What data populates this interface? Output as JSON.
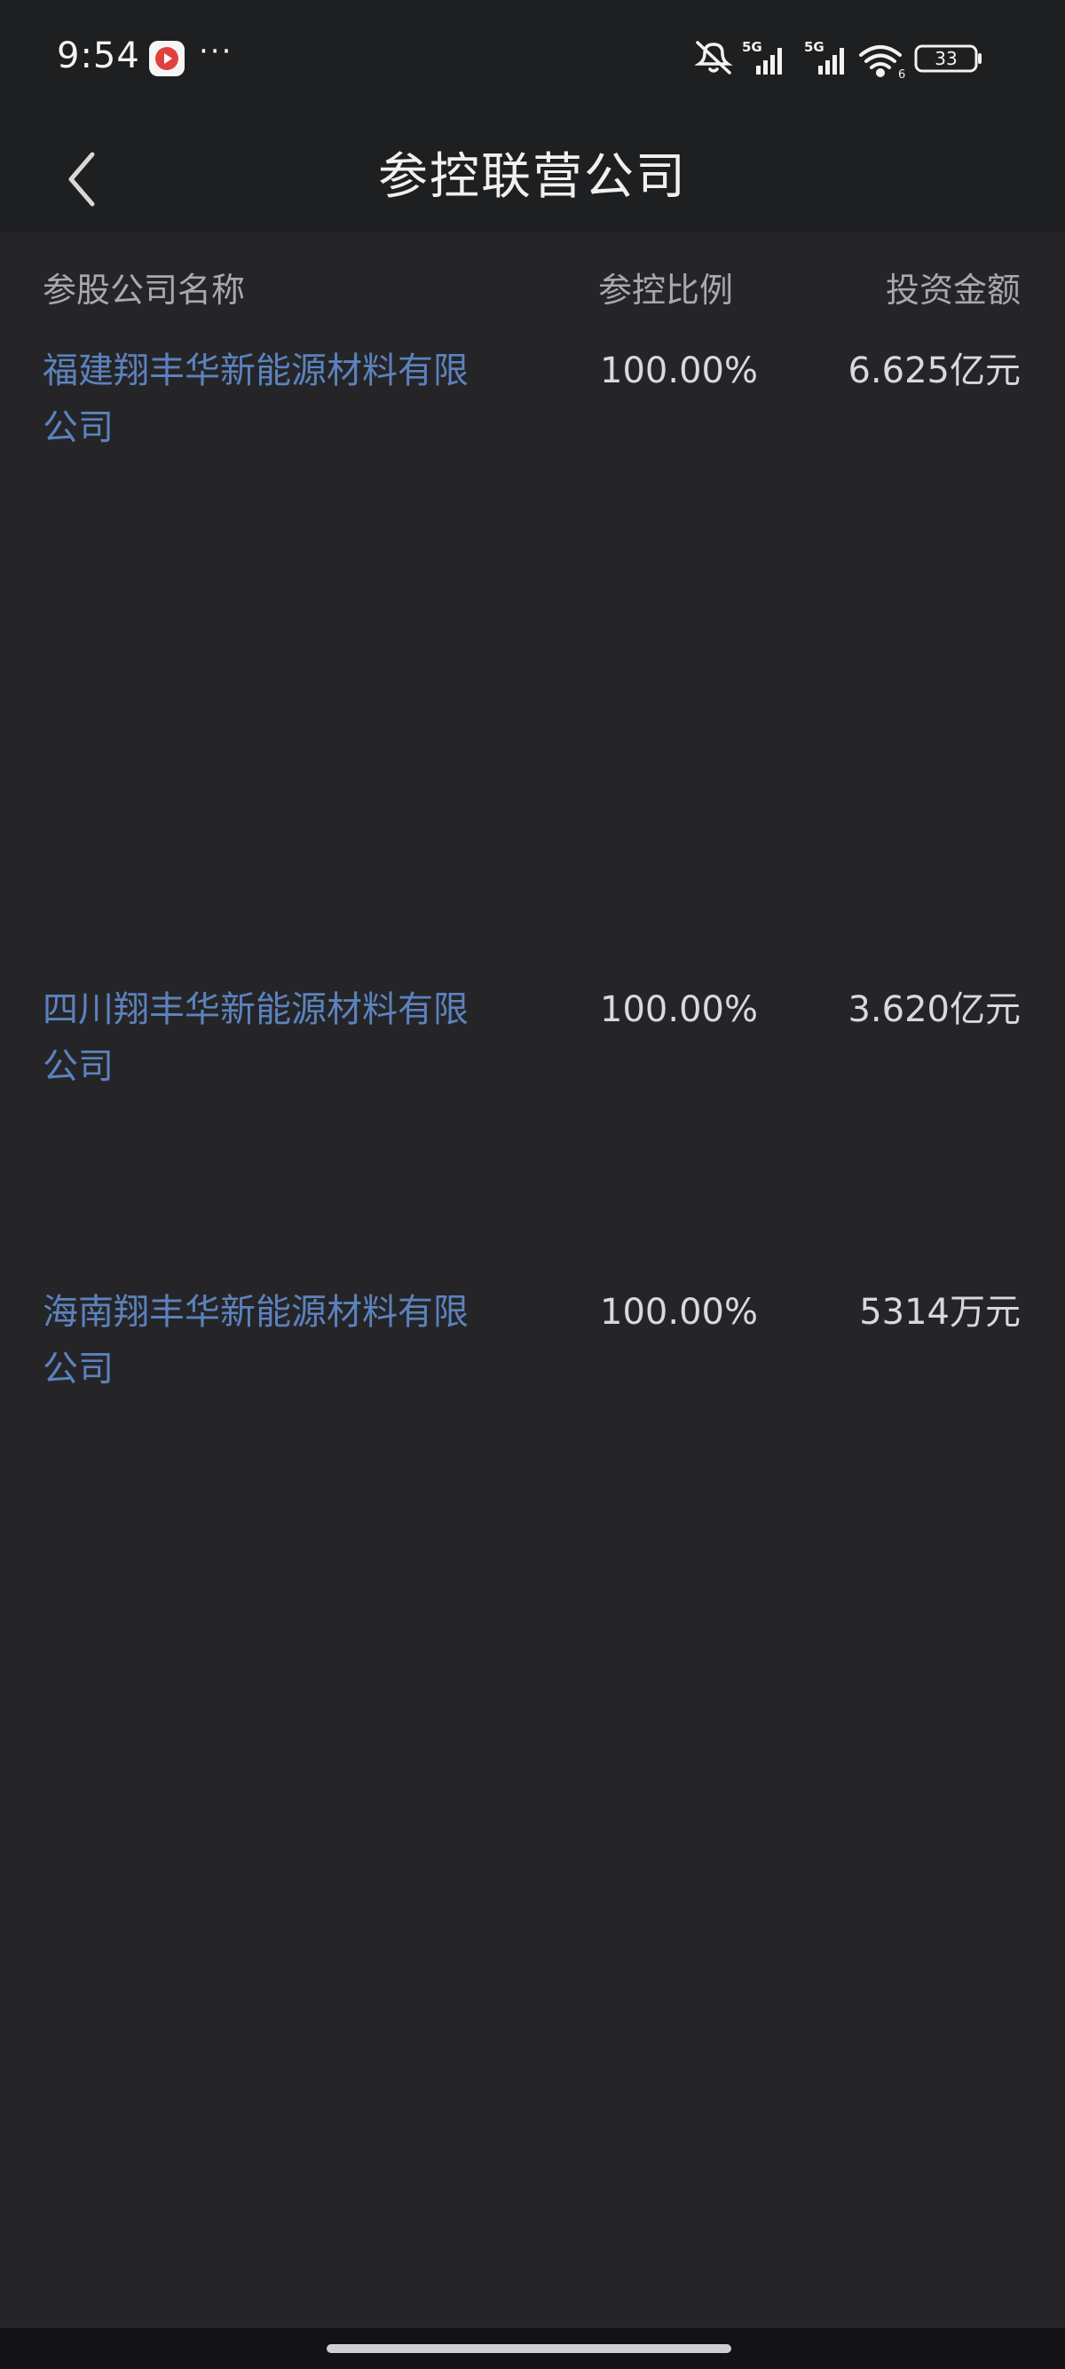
{
  "status_bar": {
    "time": "9:54",
    "more": "···",
    "network_1": "5G",
    "network_2": "5G",
    "battery": "33",
    "icons": [
      "app-notification-icon",
      "mute-icon",
      "signal-icon",
      "wifi-icon",
      "battery-icon"
    ]
  },
  "header": {
    "title": "参控联营公司",
    "back_icon": "chevron-left-icon"
  },
  "table": {
    "columns": {
      "name": "参股公司名称",
      "ratio": "参控比例",
      "amount": "投资金额"
    },
    "rows": [
      {
        "name": "福建翔丰华新能源材料有限公司",
        "ratio": "100.00%",
        "amount": "6.625亿元"
      },
      {
        "name": "四川翔丰华新能源材料有限公司",
        "ratio": "100.00%",
        "amount": "3.620亿元"
      },
      {
        "name": "海南翔丰华新能源材料有限公司",
        "ratio": "100.00%",
        "amount": "5314万元"
      }
    ]
  },
  "colors": {
    "background": "#252528",
    "topbar": "#1e1f21",
    "link": "#5c82bd",
    "text": "#d9d9dc",
    "header_text": "#a9a9ad"
  }
}
